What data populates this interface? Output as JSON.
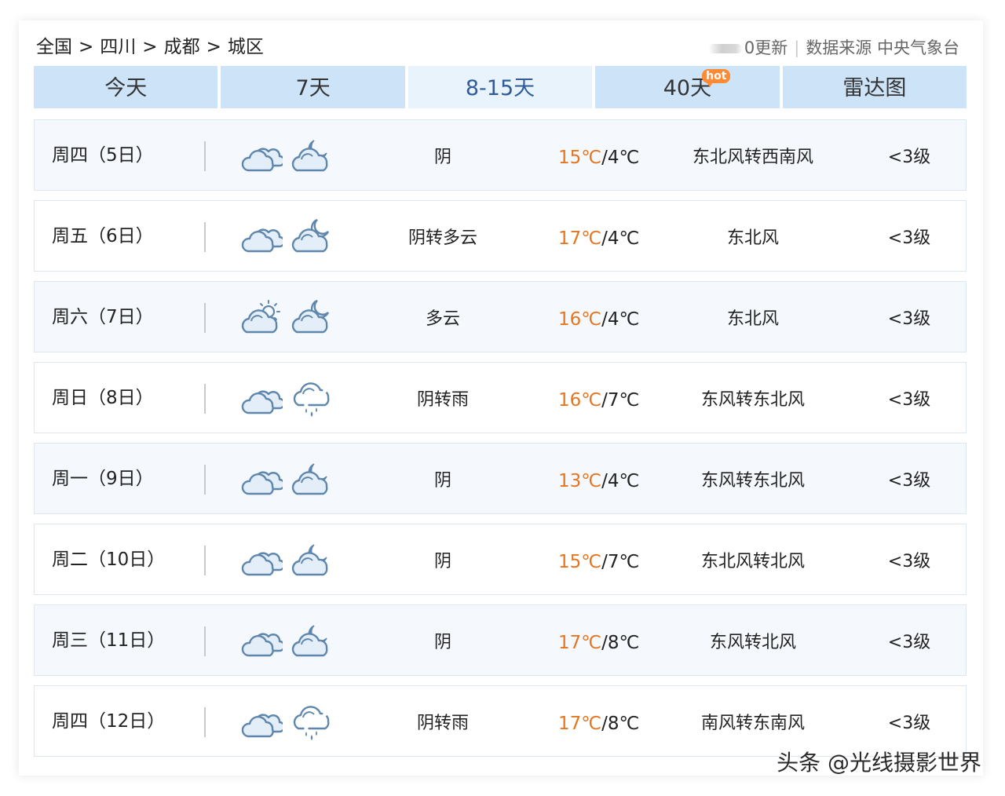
{
  "breadcrumb": [
    "全国",
    "四川",
    "成都",
    "城区"
  ],
  "breadcrumb_sep": ">",
  "source": {
    "update_text": "0更新",
    "label": "数据来源",
    "provider": "中央气象台"
  },
  "tabs": [
    {
      "label": "今天"
    },
    {
      "label": "7天"
    },
    {
      "label": "8-15天",
      "active": true
    },
    {
      "label": "40天",
      "badge": "hot"
    },
    {
      "label": "雷达图"
    }
  ],
  "colors": {
    "tab_bg": "#cde3f7",
    "tab_active_bg": "#e9f3fc",
    "tab_active_text": "#2f5b9a",
    "high_temp": "#e5751e",
    "hot_badge": "#ff8a34",
    "icon_stroke": "#5f86ac",
    "icon_fill": "#e3eef8"
  },
  "forecast": [
    {
      "day": "周四（5日）",
      "icon_day": "cloudy-icon",
      "icon_night": "cloudy-moon-icon",
      "condition": "阴",
      "high": "15℃",
      "low": "/4℃",
      "wind": "东北风转西南风",
      "level": "<3级"
    },
    {
      "day": "周五（6日）",
      "icon_day": "cloudy-icon",
      "icon_night": "partly-cloudy-night-icon",
      "condition": "阴转多云",
      "high": "17℃",
      "low": "/4℃",
      "wind": "东北风",
      "level": "<3级"
    },
    {
      "day": "周六（7日）",
      "icon_day": "partly-cloudy-day-icon",
      "icon_night": "partly-cloudy-night-icon",
      "condition": "多云",
      "high": "16℃",
      "low": "/4℃",
      "wind": "东北风",
      "level": "<3级"
    },
    {
      "day": "周日（8日）",
      "icon_day": "cloudy-icon",
      "icon_night": "rain-icon",
      "condition": "阴转雨",
      "high": "16℃",
      "low": "/7℃",
      "wind": "东风转东北风",
      "level": "<3级"
    },
    {
      "day": "周一（9日）",
      "icon_day": "cloudy-icon",
      "icon_night": "cloudy-moon-icon",
      "condition": "阴",
      "high": "13℃",
      "low": "/4℃",
      "wind": "东风转东北风",
      "level": "<3级"
    },
    {
      "day": "周二（10日）",
      "icon_day": "cloudy-icon",
      "icon_night": "cloudy-moon-icon",
      "condition": "阴",
      "high": "15℃",
      "low": "/7℃",
      "wind": "东北风转北风",
      "level": "<3级"
    },
    {
      "day": "周三（11日）",
      "icon_day": "cloudy-icon",
      "icon_night": "cloudy-moon-icon",
      "condition": "阴",
      "high": "17℃",
      "low": "/8℃",
      "wind": "东风转北风",
      "level": "<3级"
    },
    {
      "day": "周四（12日）",
      "icon_day": "cloudy-icon",
      "icon_night": "rain-icon",
      "condition": "阴转雨",
      "high": "17℃",
      "low": "/8℃",
      "wind": "南风转东南风",
      "level": "<3级"
    }
  ],
  "watermark": "头条 @光线摄影世界"
}
